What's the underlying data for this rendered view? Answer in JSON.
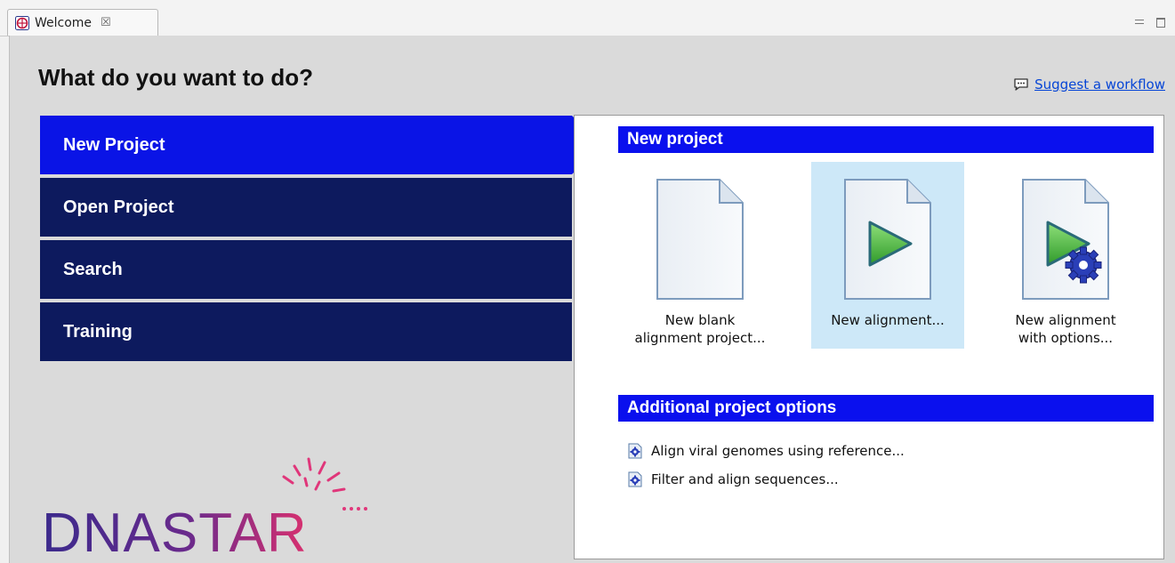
{
  "tab": {
    "title": "Welcome",
    "close_glyph": "☒",
    "icon": "globe-icon"
  },
  "window": {
    "minimize": "minimize-icon",
    "maximize": "maximize-icon"
  },
  "heading": "What do you want to do?",
  "suggest_link": {
    "label": "Suggest a workflow",
    "icon": "speech-bubble-icon"
  },
  "nav": {
    "items": [
      {
        "label": "New Project",
        "active": true
      },
      {
        "label": "Open Project",
        "active": false
      },
      {
        "label": "Search",
        "active": false
      },
      {
        "label": "Training",
        "active": false
      }
    ]
  },
  "new_project": {
    "title": "New project",
    "tiles": [
      {
        "label": "New blank\nalignment project...",
        "icon": "blank-document-icon",
        "highlighted": false
      },
      {
        "label": "New alignment...",
        "icon": "document-play-icon",
        "highlighted": true
      },
      {
        "label": "New alignment\nwith options...",
        "icon": "document-play-gear-icon",
        "highlighted": false
      }
    ]
  },
  "additional": {
    "title": "Additional project options",
    "items": [
      {
        "label": "Align viral genomes using reference...",
        "icon": "workflow-gear-icon"
      },
      {
        "label": "Filter and align sequences...",
        "icon": "workflow-gear-icon"
      }
    ]
  },
  "logo": {
    "text": "DNASTAR"
  },
  "colors": {
    "nav_dark": "#0d1a5e",
    "nav_active": "#0a14e6",
    "section_bar": "#0a10ee",
    "link": "#0645d6",
    "tile_highlight": "#cde8f8",
    "logo_text": "#3b2a8c",
    "logo_sparkle": "#e0367a"
  }
}
